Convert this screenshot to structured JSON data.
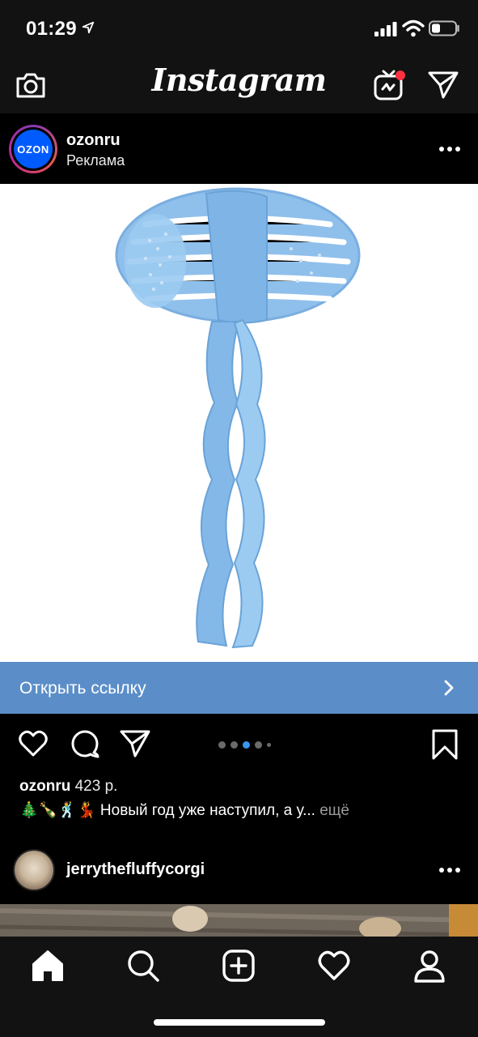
{
  "status_bar": {
    "time": "01:29",
    "icons": [
      "location-arrow-icon",
      "cellular-signal-icon",
      "wifi-icon",
      "battery-icon"
    ]
  },
  "top_nav": {
    "logo": "Instagram",
    "icons": [
      "camera-icon",
      "igtv-icon",
      "direct-message-icon"
    ],
    "igtv_badge_color": "#ff3040"
  },
  "post": {
    "avatar_text": "OZON",
    "username": "ozonru",
    "sponsored_label": "Реклама",
    "image_subject": "blue plastic wand",
    "cta_label": "Открыть ссылку",
    "cta_color": "#5b8ec8",
    "carousel": {
      "count": 5,
      "active_index": 2
    },
    "caption_user": "ozonru",
    "caption_price": "423 р.",
    "caption_emoji": "🎄🍾🕺💃",
    "caption_text": "Новый год уже наступил, а у...",
    "caption_more": "ещё"
  },
  "next_post": {
    "username": "jerrythefluffycorgi"
  },
  "tab_bar": {
    "tabs": [
      "home-icon",
      "search-icon",
      "new-post-icon",
      "activity-heart-icon",
      "profile-icon"
    ],
    "active_tab": "home-icon"
  },
  "colors": {
    "background": "#000000",
    "bars": "#121212",
    "accent_blue": "#3897f0",
    "ozon_blue": "#005bff"
  }
}
